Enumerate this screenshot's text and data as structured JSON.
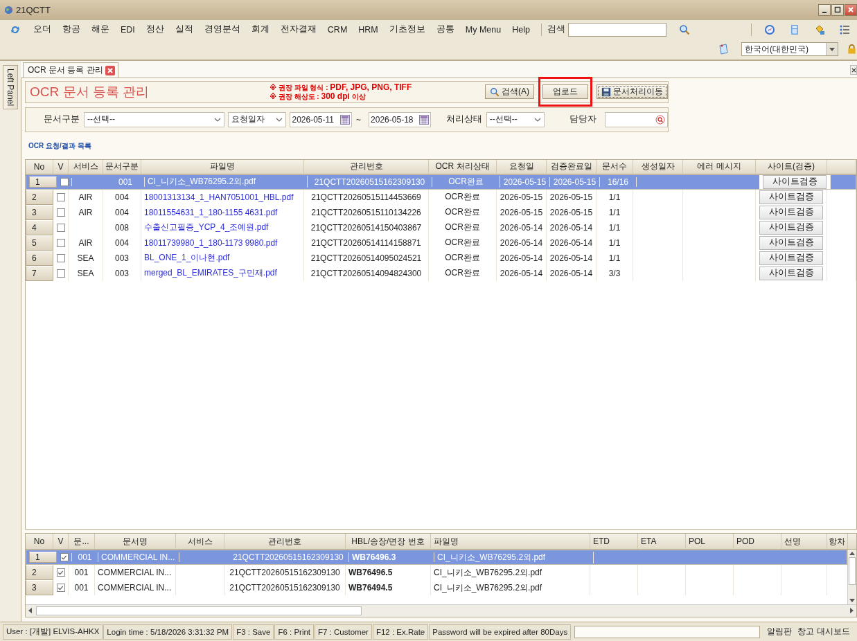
{
  "window": {
    "title": "21QCTT"
  },
  "menu": {
    "items": [
      "오더",
      "항공",
      "해운",
      "EDI",
      "정산",
      "실적",
      "경영분석",
      "회계",
      "전자결재",
      "CRM",
      "HRM",
      "기초정보",
      "공통",
      "My Menu",
      "Help"
    ],
    "search_label": "검색"
  },
  "language": {
    "value": "한국어(대한민국)"
  },
  "left_panel": {
    "label": "Left Panel"
  },
  "tabs": [
    {
      "label": "OCR 문서 등록 관리",
      "selected": true
    }
  ],
  "header": {
    "title": "OCR 문서 등록 관리",
    "notes": [
      "※ 권장 파일 형식 : **PDF, JPG, PNG, TIFF**",
      "※ 권장 해상도 : **300 dpi** 이상"
    ],
    "buttons": [
      {
        "label": "검색(A)",
        "kind": "search",
        "highlighted": false
      },
      {
        "label": "업로드",
        "kind": "plain",
        "highlighted": true
      },
      {
        "label": "문서처리이동",
        "kind": "save",
        "highlighted": false
      }
    ]
  },
  "filters": {
    "doc_type": {
      "label": "문서구분",
      "value": "--선택--"
    },
    "date_type": {
      "value": "요청일자"
    },
    "date_from": {
      "value": "2026-05-11"
    },
    "separator": "~",
    "date_to": {
      "value": "2026-05-18"
    },
    "status": {
      "label": "처리상태",
      "value": "--선택--"
    },
    "owner": {
      "label": "담당자"
    }
  },
  "list_title": "OCR 요청/결과 목록",
  "requests": {
    "columns": [
      {
        "kind": "no",
        "label": "No"
      },
      {
        "kind": "checked",
        "label": "V"
      },
      {
        "kind": "service",
        "label": "서비스"
      },
      {
        "kind": "doc_type",
        "label": "문서구분"
      },
      {
        "kind": "file",
        "label": "파일명"
      },
      {
        "kind": "id",
        "label": "관리번호"
      },
      {
        "kind": "status",
        "label": "OCR 처리상태"
      },
      {
        "kind": "requested",
        "label": "요청일"
      },
      {
        "kind": "verified",
        "label": "검증완료일"
      },
      {
        "kind": "pages",
        "label": "문서수"
      },
      {
        "kind": "created",
        "label": "생성일자"
      },
      {
        "kind": "error",
        "label": "에러 메시지"
      },
      {
        "kind": "site",
        "label": "사이트(검증)"
      }
    ],
    "rows": [
      {
        "no": "1",
        "checked": false,
        "selected": true,
        "doc_type": "001",
        "file": "CI_니키소_WB76295.2외.pdf",
        "id": "21QCTT20260515162309130",
        "status": "OCR완료",
        "requested": "2026-05-15",
        "verified": "2026-05-15",
        "pages": "16/16",
        "site": "사이트검증"
      },
      {
        "no": "2",
        "checked": false,
        "selected": false,
        "service": "AIR",
        "doc_type": "004",
        "file": "18001313134_1_HAN7051001_HBL.pdf",
        "id": "21QCTT20260515114453669",
        "status": "OCR완료",
        "requested": "2026-05-15",
        "verified": "2026-05-15",
        "pages": "1/1",
        "site": "사이트검증"
      },
      {
        "no": "3",
        "checked": false,
        "selected": false,
        "service": "AIR",
        "doc_type": "004",
        "file": "18011554631_1_180-1155 4631.pdf",
        "id": "21QCTT20260515110134226",
        "status": "OCR완료",
        "requested": "2026-05-15",
        "verified": "2026-05-15",
        "pages": "1/1",
        "site": "사이트검증"
      },
      {
        "no": "4",
        "checked": false,
        "selected": false,
        "doc_type": "008",
        "file": "수출신고필증_YCP_4_조예원.pdf",
        "id": "21QCTT20260514150403867",
        "status": "OCR완료",
        "requested": "2026-05-14",
        "verified": "2026-05-14",
        "pages": "1/1",
        "site": "사이트검증"
      },
      {
        "no": "5",
        "checked": false,
        "selected": false,
        "service": "AIR",
        "doc_type": "004",
        "file": "18011739980_1_180-1173 9980.pdf",
        "id": "21QCTT20260514114158871",
        "status": "OCR완료",
        "requested": "2026-05-14",
        "verified": "2026-05-14",
        "pages": "1/1",
        "site": "사이트검증"
      },
      {
        "no": "6",
        "checked": false,
        "selected": false,
        "service": "SEA",
        "doc_type": "003",
        "file": "BL_ONE_1_이나현.pdf",
        "id": "21QCTT20260514095024521",
        "status": "OCR완료",
        "requested": "2026-05-14",
        "verified": "2026-05-14",
        "pages": "1/1",
        "site": "사이트검증"
      },
      {
        "no": "7",
        "checked": false,
        "selected": false,
        "service": "SEA",
        "doc_type": "003",
        "file": "merged_BL_EMIRATES_구민재.pdf",
        "id": "21QCTT20260514094824300",
        "status": "OCR완료",
        "requested": "2026-05-14",
        "verified": "2026-05-14",
        "pages": "3/3",
        "site": "사이트검증"
      }
    ]
  },
  "documents": {
    "columns": [
      {
        "kind": "no",
        "label": "No"
      },
      {
        "kind": "checked",
        "label": "V"
      },
      {
        "kind": "code",
        "label": "문..."
      },
      {
        "kind": "name",
        "label": "문서명"
      },
      {
        "kind": "service",
        "label": "서비스"
      },
      {
        "kind": "id",
        "label": "관리번호"
      },
      {
        "kind": "hbl",
        "label": "HBL/송장/면장 번호"
      },
      {
        "kind": "file",
        "label": "파일명"
      },
      {
        "kind": "etd",
        "label": "ETD"
      },
      {
        "kind": "eta",
        "label": "ETA"
      },
      {
        "kind": "pol",
        "label": "POL"
      },
      {
        "kind": "pod",
        "label": "POD"
      },
      {
        "kind": "vessel",
        "label": "선명"
      },
      {
        "kind": "voyage",
        "label": "항차"
      }
    ],
    "rows": [
      {
        "no": "1",
        "checked": true,
        "selected": true,
        "code": "001",
        "name": "COMMERCIAL IN...",
        "id": "21QCTT20260515162309130",
        "hbl": "WB76496.3",
        "file": "CI_니키소_WB76295.2외.pdf"
      },
      {
        "no": "2",
        "checked": true,
        "selected": false,
        "code": "001",
        "name": "COMMERCIAL IN...",
        "id": "21QCTT20260515162309130",
        "hbl": "WB76496.5",
        "file": "CI_니키소_WB76295.2외.pdf"
      },
      {
        "no": "3",
        "checked": true,
        "selected": false,
        "code": "001",
        "name": "COMMERCIAL IN...",
        "id": "21QCTT20260515162309130",
        "hbl": "WB76494.5",
        "file": "CI_니키소_WB76295.2외.pdf"
      }
    ]
  },
  "status_bar": {
    "items": [
      "User : [개발] ELVIS-AHKX",
      "Login time : 5/18/2026 3:31:32 PM",
      "F3 : Save",
      "F6 : Print",
      "F7 : Customer",
      "F12 : Ex.Rate",
      "Password will be expired after 80Days"
    ],
    "links": [
      "알림판",
      "창고 대시보드"
    ]
  }
}
